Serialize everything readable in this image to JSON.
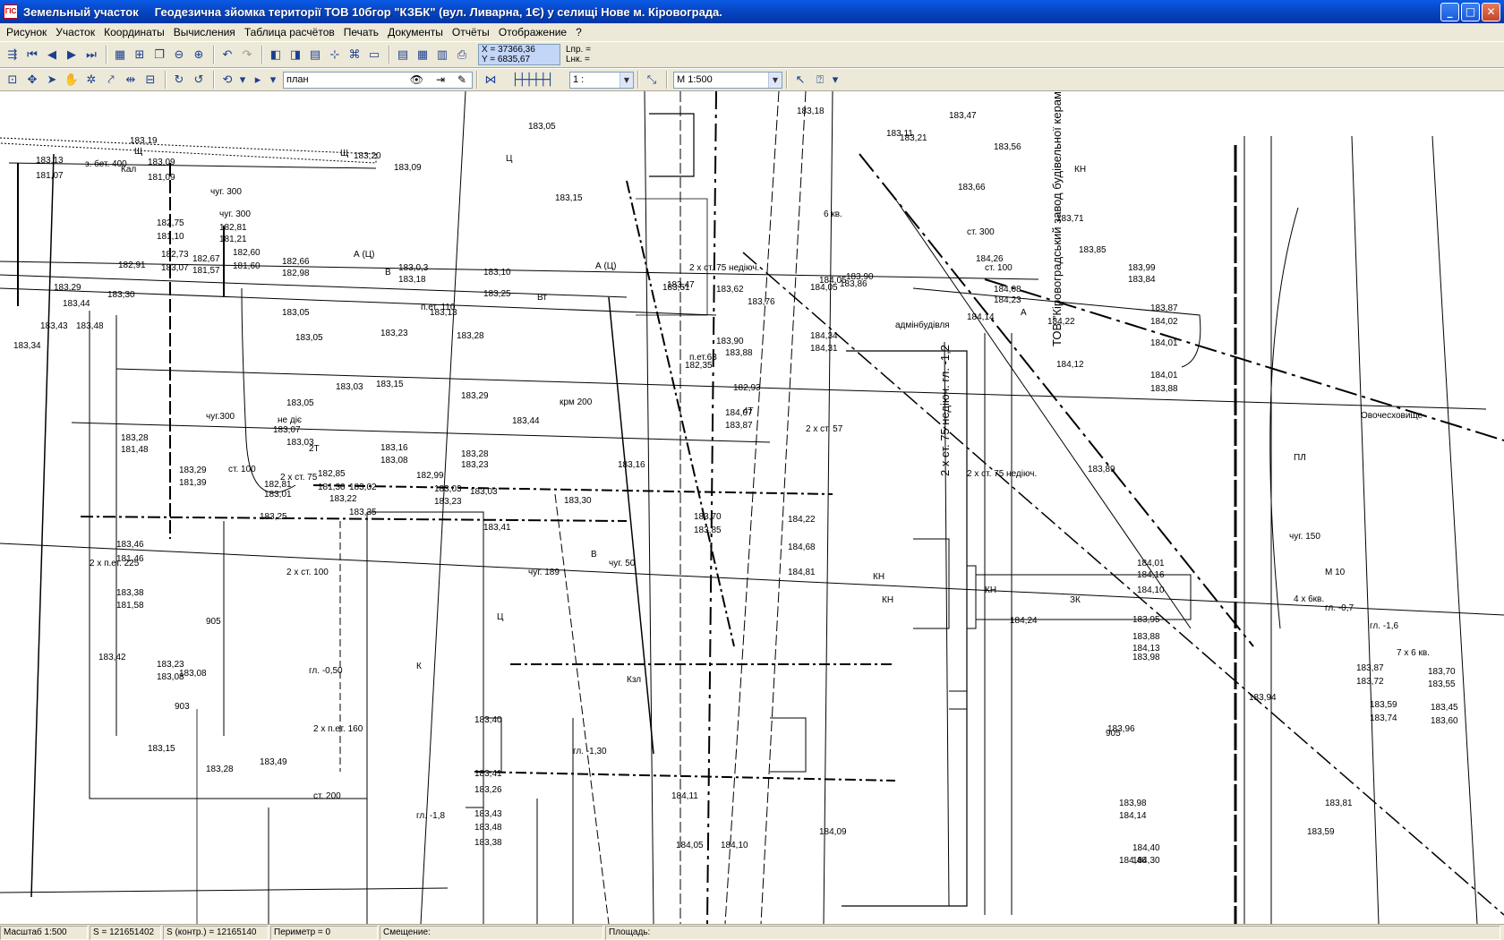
{
  "window": {
    "title": "Земельный участок     Геодезична зйомка території ТОВ 10бгор \"КЗБК\" (вул. Ливарна, 1Є) у селищі Нове м. Кіровограда.",
    "app_icon_text": "ГІС"
  },
  "menu": [
    "Рисунок",
    "Участок",
    "Координаты",
    "Вычисления",
    "Таблица расчётов",
    "Печать",
    "Документы",
    "Отчёты",
    "Отображение",
    "?"
  ],
  "toolbar": {
    "coord_x": "X = 37366,36",
    "coord_y": "Y = 6835,67",
    "lpr": "Lпр. =",
    "lnk": "Lнк. =",
    "layer_value": "план",
    "ratio_value": "1 :",
    "scale_value": "M 1:500"
  },
  "map": {
    "labels": [
      "183,19",
      "183,13",
      "181,07",
      "183,09",
      "181,09",
      "183,20",
      "183,09",
      "183,05",
      "183,15",
      "183,18",
      "182,75",
      "181,10",
      "182,81",
      "181,21",
      "182,60",
      "181,60",
      "182,67",
      "181,57",
      "182,73",
      "182,91",
      "183,07",
      "182,66",
      "182,98",
      "183,0,3",
      "183,18",
      "183,10",
      "183,25",
      "183,05",
      "183,13",
      "183,29",
      "183,30",
      "183,44",
      "183,43",
      "183,48",
      "183,34",
      "183,05",
      "183,23",
      "183,28",
      "183,03",
      "183,15",
      "183,29",
      "183,05",
      "183,07",
      "183,03",
      "183,16",
      "183,08",
      "183,28",
      "183,23",
      "183,44",
      "183,28",
      "181,48",
      "183,29",
      "181,39",
      "182,85",
      "182,81",
      "181,30",
      "183,01",
      "183,02",
      "183,22",
      "183,35",
      "183,25",
      "182,99",
      "183,03",
      "183,23",
      "183,03",
      "183,41",
      "183,30",
      "183,70",
      "183,85",
      "184,22",
      "184,68",
      "184,81",
      "183,46",
      "181,46",
      "183,38",
      "181,58",
      "183,42",
      "183,23",
      "183,08",
      "183,16",
      "183,15",
      "183,28",
      "183,49",
      "183,40",
      "183,41",
      "183,26",
      "183,43",
      "183,48",
      "183,38",
      "184,11",
      "184,05",
      "184,10",
      "184,09",
      "183,47",
      "183,21",
      "183,11",
      "183,56",
      "183,66",
      "183,71",
      "184,26",
      "183,85",
      "183,99",
      "183,84",
      "184,08",
      "184,23",
      "183,87",
      "184,02",
      "184,01",
      "184,14",
      "184,22",
      "184,12",
      "184,01",
      "183,88",
      "183,89",
      "184,01",
      "184,16",
      "184,10",
      "183,95",
      "183,88",
      "184,13",
      "183,98",
      "184,24",
      "183,87",
      "183,72",
      "183,70",
      "183,55",
      "183,94",
      "183,59",
      "183,74",
      "183,45",
      "183,60",
      "183,96",
      "183,98",
      "184,14",
      "184,40",
      "184,30",
      "184,46",
      "183,08",
      "183,81",
      "183,90",
      "184,34",
      "184,31",
      "183,76",
      "183,88",
      "182,35",
      "182,93",
      "184,07",
      "183,87",
      "183,59",
      "183,51",
      "183,47",
      "183,62",
      "184,05",
      "183,86",
      "183,90",
      "184,05"
    ],
    "annotations": [
      "Щ",
      "Щ",
      "Ц",
      "Кал",
      "з. бет. 400",
      "чуг. 300",
      "чуг. 300",
      "А (Ц)",
      "А (Ц)",
      "В",
      "Вт",
      "п.ет. 110",
      "чуг.300",
      "не діє",
      "2Т",
      "2 х ст. 75",
      "ст. 100",
      "ст. 200",
      "К",
      "Ц",
      "КН",
      "КН",
      "КН",
      "КН",
      "ЗК",
      "адмінбудівля",
      "ТОВ \"Кіровоградський завод будівельної кераміки\"",
      "Овочесховище",
      "ПЛ",
      "2 х ст. 75 недіюч.",
      "2 х ст. 75 недіюч.  гл. -1,2",
      "2 х ст. 75 недіюч.",
      "М 10",
      "чуг. 150",
      "гл. -0,7",
      "гл. -1,6",
      "ст. 300",
      "2 х п.ет. 225",
      "2 х п.ет. 160",
      "гл. -0,50",
      "903",
      "905",
      "905",
      "2 х ст. 100",
      "гл. -1,8",
      "гл. -1,30",
      "чуг. 189",
      "чуг. 50",
      "ст. 100",
      "6 кв.",
      "4 х 6кв.",
      "7 х 6 кв.",
      "2 х ст. 57",
      "4Т",
      "Кзл",
      "крм 200",
      "В",
      "А",
      "п.ет.63"
    ]
  },
  "status": {
    "scale": "Масштаб 1:500",
    "s": "S = 121651402",
    "s_control": "S (контр.) = 12165140",
    "perimeter": "Периметр = 0",
    "offset": "Смещение:",
    "area": "Площадь:"
  }
}
